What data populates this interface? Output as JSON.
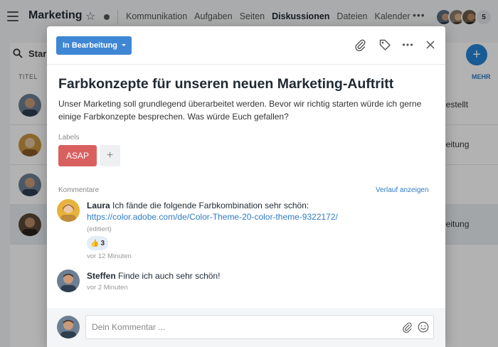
{
  "app": {
    "title": "Marketing",
    "nav": [
      "Kommunikation",
      "Aufgaben",
      "Seiten",
      "Diskussionen",
      "Dateien",
      "Kalender"
    ],
    "nav_more": "•••",
    "member_count": "5"
  },
  "list": {
    "search_label": "Star",
    "col_title": "TITEL",
    "col_more": "MEHR",
    "row_statuses": [
      "gestellt",
      "beitung",
      "",
      "beitung"
    ]
  },
  "modal": {
    "status_label": "In Bearbeitung",
    "title": "Farbkonzepte für unseren neuen Marketing-Auftritt",
    "description": "Unser Marketing soll grundlegend überarbeitet werden. Bevor wir richtig starten würde ich gerne einige Farbkonzepte besprechen. Was würde Euch gefallen?",
    "labels_heading": "Labels",
    "label_asap": "ASAP",
    "add_label": "+",
    "comments_heading": "Kommentare",
    "history_link": "Verlauf anzeigen",
    "comments": [
      {
        "author": "Laura",
        "text": "Ich fände die folgende Farbkombination sehr schön:",
        "link": "https://color.adobe.com/de/Color-Theme-20-color-theme-9322172/",
        "edited": "(editiert)",
        "reaction_emoji": "👍",
        "reaction_count": "3",
        "time": "vor 12 Minuten"
      },
      {
        "author": "Steffen",
        "text": "Finde ich auch sehr schön!",
        "time": "vor 2 Minuten"
      }
    ],
    "comment_placeholder": "Dein Kommentar ..."
  },
  "colors": {
    "accent": "#3f86d4",
    "label_asap": "#d8615f",
    "link": "#2f7bc4"
  },
  "icons": [
    "hamburger-icon",
    "star-icon",
    "paperclip-icon",
    "tag-icon",
    "more-icon",
    "close-icon",
    "emoji-icon",
    "search-icon",
    "plus-icon"
  ]
}
